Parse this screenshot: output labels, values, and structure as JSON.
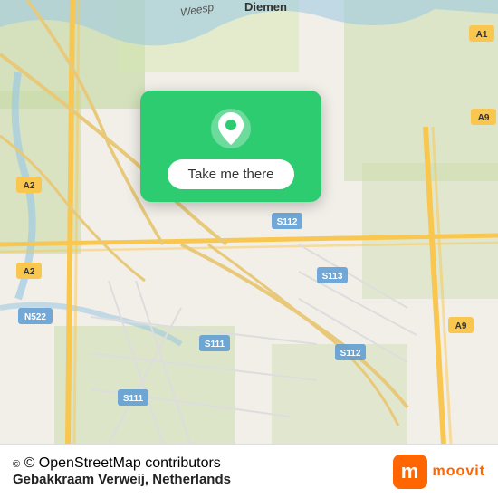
{
  "map": {
    "attribution": "© OpenStreetMap contributors",
    "background_color": "#e8e0d8"
  },
  "popup": {
    "button_label": "Take me there",
    "pin_icon": "location-pin"
  },
  "bottom_bar": {
    "place_name": "Gebakkraam Verweij, Netherlands",
    "moovit_logo_letter": "m",
    "moovit_logo_text": "moovit"
  }
}
